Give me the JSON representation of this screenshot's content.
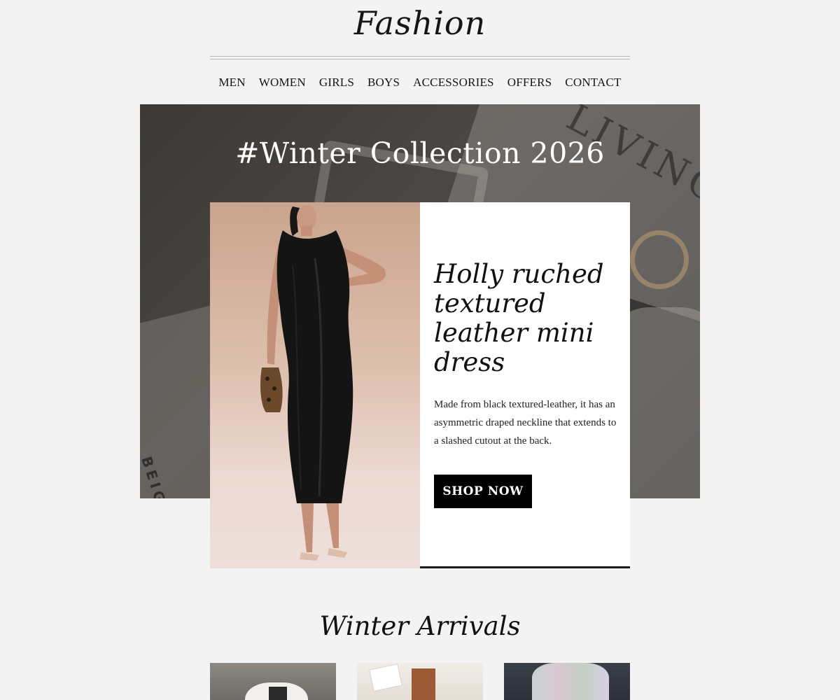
{
  "brand": {
    "logo_text": "Fashion"
  },
  "nav": {
    "items": [
      "MEN",
      "WOMEN",
      "GIRLS",
      "BOYS",
      "ACCESSORIES",
      "OFFERS",
      "CONTACT"
    ]
  },
  "hero": {
    "title": "#Winter Collection 2026",
    "background_text_1": "LIVING",
    "background_text_2": "BEIGIC"
  },
  "feature": {
    "title": "Holly ruched textured leather mini dress",
    "description": "Made from black textured-leather, it has an asymmetric draped neckline that extends to a slashed cutout at the back.",
    "button_label": "SHOP NOW",
    "image_alt": "Model wearing black leather dress"
  },
  "arrivals": {
    "title": "Winter Arrivals",
    "items": [
      {
        "image": "white-jacket"
      },
      {
        "image": "brown-vest"
      },
      {
        "image": "pastel-scarf"
      }
    ]
  },
  "colors": {
    "page_bg": "#f3f3f3",
    "accent": "#000000",
    "text": "#111111"
  }
}
